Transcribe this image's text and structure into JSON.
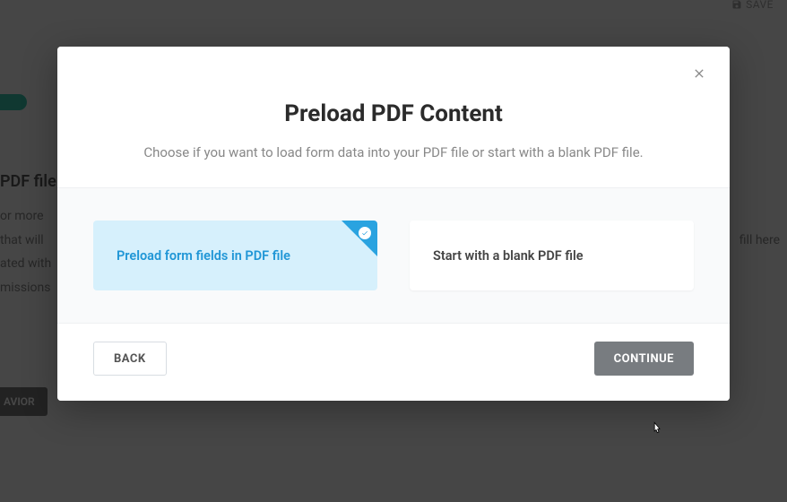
{
  "background": {
    "save_label": "SAVE",
    "section_heading": "PDF file",
    "paragraph_l1": "or more",
    "paragraph_l2": "that will",
    "paragraph_l2_right": "fill here",
    "paragraph_l3": "ated with",
    "paragraph_l4": "missions",
    "behavior_button": "AVIOR"
  },
  "modal": {
    "title": "Preload PDF Content",
    "subtitle": "Choose if you want to load form data into your PDF file or start with a blank PDF file.",
    "options": {
      "preload": {
        "label": "Preload form fields in PDF file",
        "selected": true
      },
      "blank": {
        "label": "Start with a blank PDF file",
        "selected": false
      }
    },
    "close_label": "Close",
    "buttons": {
      "back": "BACK",
      "continue": "CONTINUE"
    }
  }
}
